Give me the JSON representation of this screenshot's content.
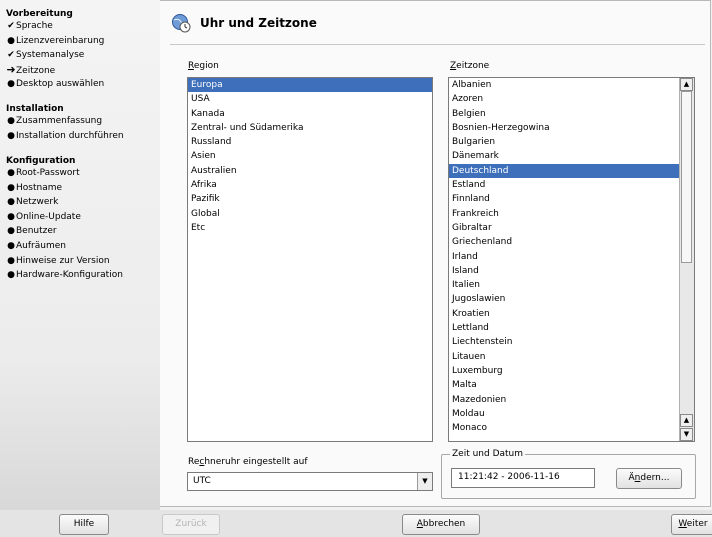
{
  "sidebar": {
    "sections": [
      {
        "title": "Vorbereitung",
        "steps": [
          {
            "label": "Sprache",
            "state": "done"
          },
          {
            "label": "Lizenzvereinbarung",
            "state": "todo"
          },
          {
            "label": "Systemanalyse",
            "state": "done"
          },
          {
            "label": "Zeitzone",
            "state": "current"
          },
          {
            "label": "Desktop auswählen",
            "state": "todo"
          }
        ]
      },
      {
        "title": "Installation",
        "steps": [
          {
            "label": "Zusammenfassung",
            "state": "todo"
          },
          {
            "label": "Installation durchführen",
            "state": "todo"
          }
        ]
      },
      {
        "title": "Konfiguration",
        "steps": [
          {
            "label": "Root-Passwort",
            "state": "todo"
          },
          {
            "label": "Hostname",
            "state": "todo"
          },
          {
            "label": "Netzwerk",
            "state": "todo"
          },
          {
            "label": "Online-Update",
            "state": "todo"
          },
          {
            "label": "Benutzer",
            "state": "todo"
          },
          {
            "label": "Aufräumen",
            "state": "todo"
          },
          {
            "label": "Hinweise zur Version",
            "state": "todo"
          },
          {
            "label": "Hardware-Konfiguration",
            "state": "todo"
          }
        ]
      }
    ],
    "marks": {
      "done": "✔",
      "current": "➜",
      "todo": "●"
    }
  },
  "header": {
    "title": "Uhr und Zeitzone",
    "icon": "clock-globe-icon"
  },
  "region": {
    "label_accel": "R",
    "label_rest": "egion",
    "items": [
      "Europa",
      "USA",
      "Kanada",
      "Zentral- und Südamerika",
      "Russland",
      "Asien",
      "Australien",
      "Afrika",
      "Pazifik",
      "Global",
      "Etc"
    ],
    "selected_index": 0
  },
  "timezone": {
    "label_pre": "",
    "label_accel": "Z",
    "label_rest": "eitzone",
    "items": [
      "Albanien",
      "Azoren",
      "Belgien",
      "Bosnien-Herzegowina",
      "Bulgarien",
      "Dänemark",
      "Deutschland",
      "Estland",
      "Finnland",
      "Frankreich",
      "Gibraltar",
      "Griechenland",
      "Irland",
      "Island",
      "Italien",
      "Jugoslawien",
      "Kroatien",
      "Lettland",
      "Liechtenstein",
      "Litauen",
      "Luxemburg",
      "Malta",
      "Mazedonien",
      "Moldau",
      "Monaco"
    ],
    "selected_index": 6,
    "scroll_position": 0.0
  },
  "hwclock": {
    "label_pre": "Re",
    "label_accel": "c",
    "label_rest": "hneruhr eingestellt auf",
    "value": "UTC"
  },
  "datetime": {
    "group_title": "Zeit und Datum",
    "value": "11:21:42 - 2006-11-16",
    "change_pre": "Ä",
    "change_accel": "n",
    "change_rest": "dern..."
  },
  "buttons": {
    "help": "Hilfe",
    "back": "Zurück",
    "abort_accel": "A",
    "abort_rest": "bbrechen",
    "next_accel": "W",
    "next_rest": "eiter"
  },
  "colors": {
    "selection": "#3d6fbb"
  }
}
